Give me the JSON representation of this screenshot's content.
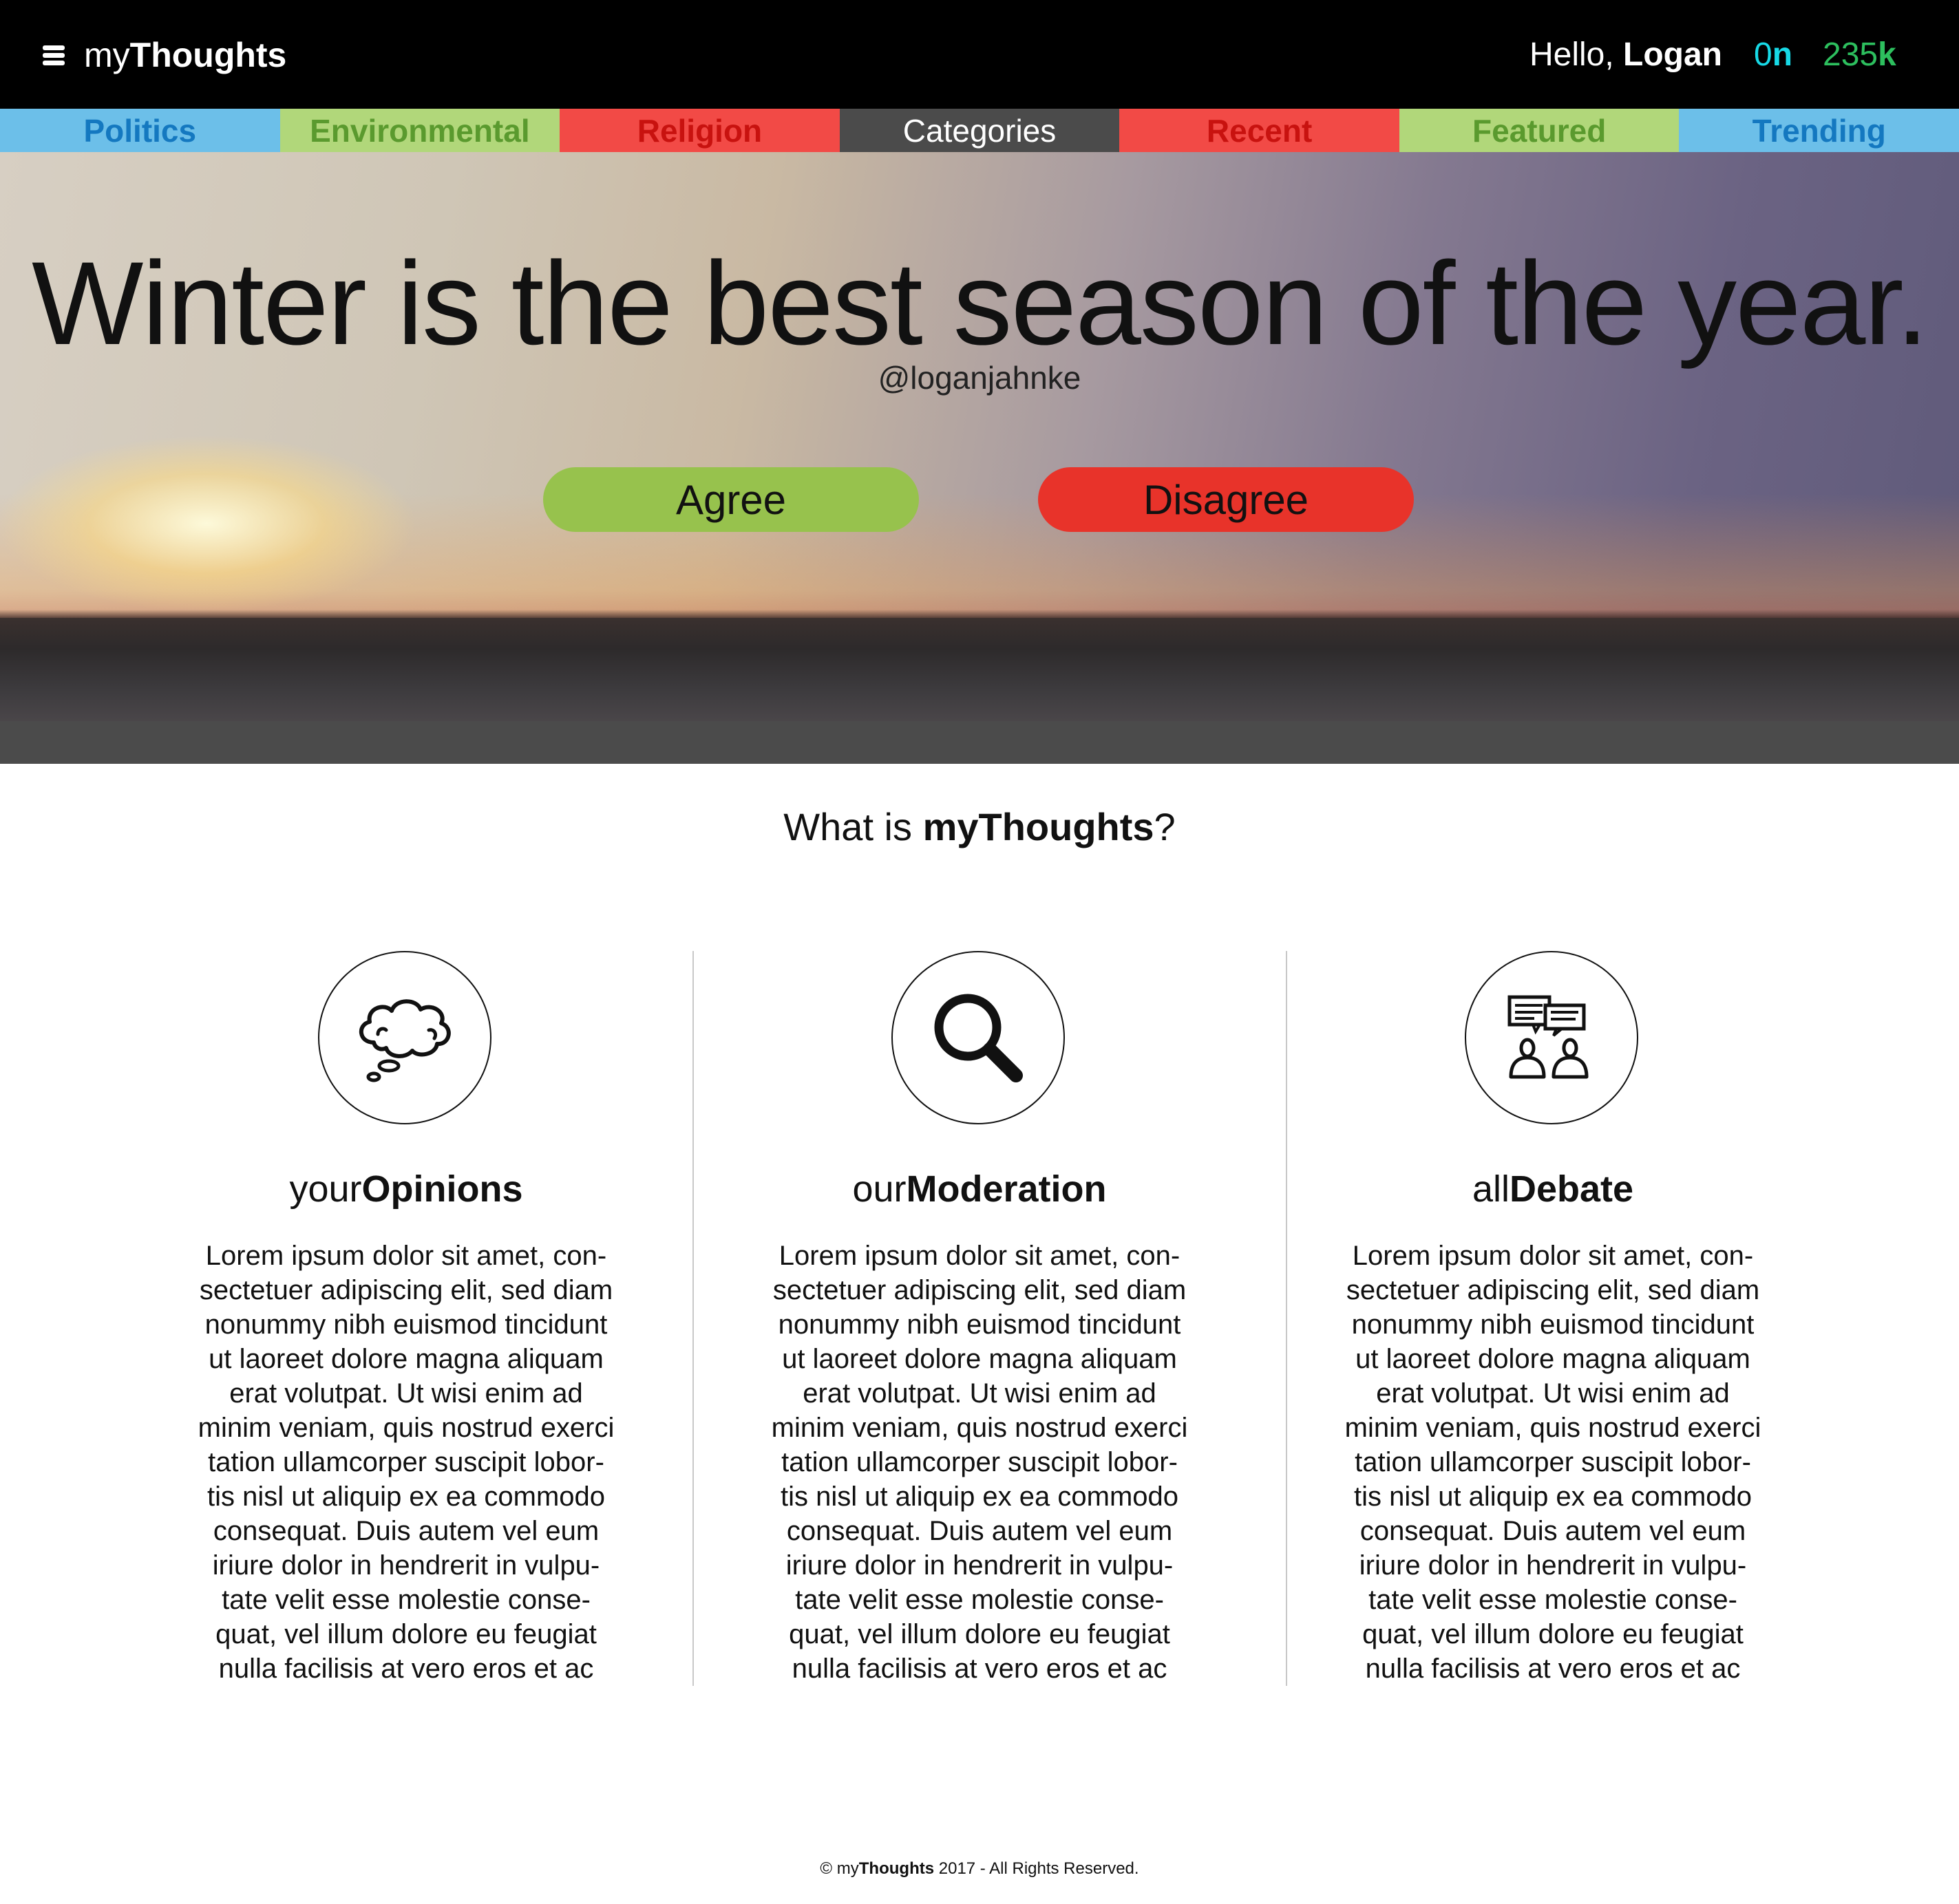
{
  "header": {
    "brand_prefix": "my",
    "brand_bold": "Thoughts",
    "greeting_prefix": "Hello, ",
    "user_name": "Logan",
    "online_value": "0",
    "online_suffix": "n",
    "count_value": "235",
    "count_suffix": "k"
  },
  "categories": [
    {
      "label": "Politics",
      "bg": "#6cbfe9",
      "color": "#1478c0"
    },
    {
      "label": "Environmental",
      "bg": "#b1d77a",
      "color": "#5a9a2e"
    },
    {
      "label": "Religion",
      "bg": "#f24a46",
      "color": "#c8120f"
    },
    {
      "label": "Categories",
      "bg": "#4b4b4b",
      "color": "#ffffff"
    },
    {
      "label": "Recent",
      "bg": "#f24a46",
      "color": "#c8120f"
    },
    {
      "label": "Featured",
      "bg": "#b1d77a",
      "color": "#5a9a2e"
    },
    {
      "label": "Trending",
      "bg": "#6cbfe9",
      "color": "#1478c0"
    }
  ],
  "hero": {
    "title": "Winter is the best season of the year.",
    "author": "@loganjahnke",
    "agree_label": "Agree",
    "disagree_label": "Disagree"
  },
  "about": {
    "title_prefix": "What is ",
    "title_bold": "myThoughts",
    "title_suffix": "?",
    "columns": [
      {
        "icon": "thought-bubble-icon",
        "title_prefix": "your",
        "title_bold": "Opinions",
        "lines": [
          "Lorem ipsum dolor sit amet, con-",
          "sectetuer adipiscing elit, sed diam",
          "nonummy nibh euismod tincidunt",
          "ut laoreet dolore magna aliquam",
          "erat volutpat. Ut wisi enim ad",
          "minim veniam, quis nostrud exerci",
          "tation ullamcorper suscipit lobor-",
          "tis nisl ut aliquip ex ea commodo",
          "consequat. Duis autem vel eum",
          "iriure dolor in hendrerit in vulpu-",
          "tate velit esse molestie conse-",
          "quat, vel illum dolore eu feugiat",
          "nulla facilisis at vero eros et ac"
        ]
      },
      {
        "icon": "magnifier-icon",
        "title_prefix": "our",
        "title_bold": "Moderation",
        "lines": [
          "Lorem ipsum dolor sit amet, con-",
          "sectetuer adipiscing elit, sed diam",
          "nonummy nibh euismod tincidunt",
          "ut laoreet dolore magna aliquam",
          "erat volutpat. Ut wisi enim ad",
          "minim veniam, quis nostrud exerci",
          "tation ullamcorper suscipit lobor-",
          "tis nisl ut aliquip ex ea commodo",
          "consequat. Duis autem vel eum",
          "iriure dolor in hendrerit in vulpu-",
          "tate velit esse molestie conse-",
          "quat, vel illum dolore eu feugiat",
          "nulla facilisis at vero eros et ac"
        ]
      },
      {
        "icon": "debate-people-icon",
        "title_prefix": "all",
        "title_bold": "Debate",
        "lines": [
          "Lorem ipsum dolor sit amet, con-",
          "sectetuer adipiscing elit, sed diam",
          "nonummy nibh euismod tincidunt",
          "ut laoreet dolore magna aliquam",
          "erat volutpat. Ut wisi enim ad",
          "minim veniam, quis nostrud exerci",
          "tation ullamcorper suscipit lobor-",
          "tis nisl ut aliquip ex ea commodo",
          "consequat. Duis autem vel eum",
          "iriure dolor in hendrerit in vulpu-",
          "tate velit esse molestie conse-",
          "quat, vel illum dolore eu feugiat",
          "nulla facilisis at vero eros et ac"
        ]
      }
    ]
  },
  "footer": {
    "prefix": "© my",
    "bold": "Thoughts",
    "suffix": " 2017 - All Rights Reserved."
  }
}
